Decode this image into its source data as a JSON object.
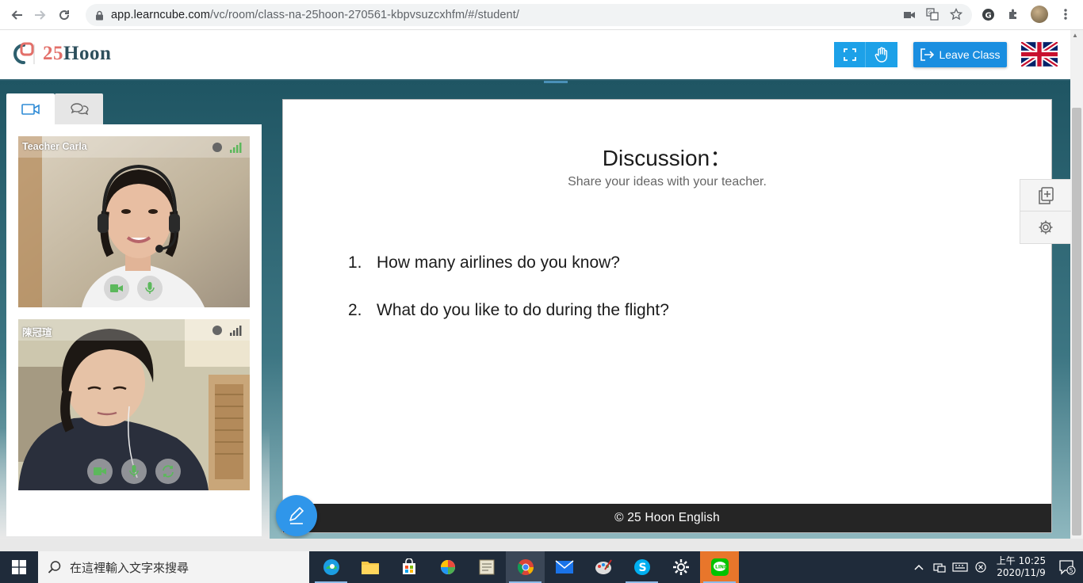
{
  "browser": {
    "url_host": "app.learncube.com",
    "url_path": "/vc/room/class-na-25hoon-270561-kbpvsuzcxhfm/#/student/"
  },
  "header": {
    "logo_num": "25",
    "logo_word": "Hoon",
    "leave_label": "Leave Class"
  },
  "videos": [
    {
      "name": "Teacher Carla"
    },
    {
      "name": "陳冠瑄"
    }
  ],
  "slide": {
    "title": "Discussion：",
    "subtitle": "Share your ideas with your teacher.",
    "questions": [
      {
        "num": "1.",
        "text": "How many airlines do you know?"
      },
      {
        "num": "2.",
        "text": "What do you like to do during the flight?"
      }
    ],
    "footer": "© 25 Hoon English"
  },
  "taskbar": {
    "search_placeholder": "在這裡輸入文字來搜尋",
    "time": "上午 10:25",
    "date": "2020/11/9",
    "notif_count": "5"
  },
  "colors": {
    "accent_blue": "#1da1e8",
    "brand_teal": "#2d5f6e",
    "brand_coral": "#e3706a",
    "video_control_green": "#5cb85c"
  }
}
